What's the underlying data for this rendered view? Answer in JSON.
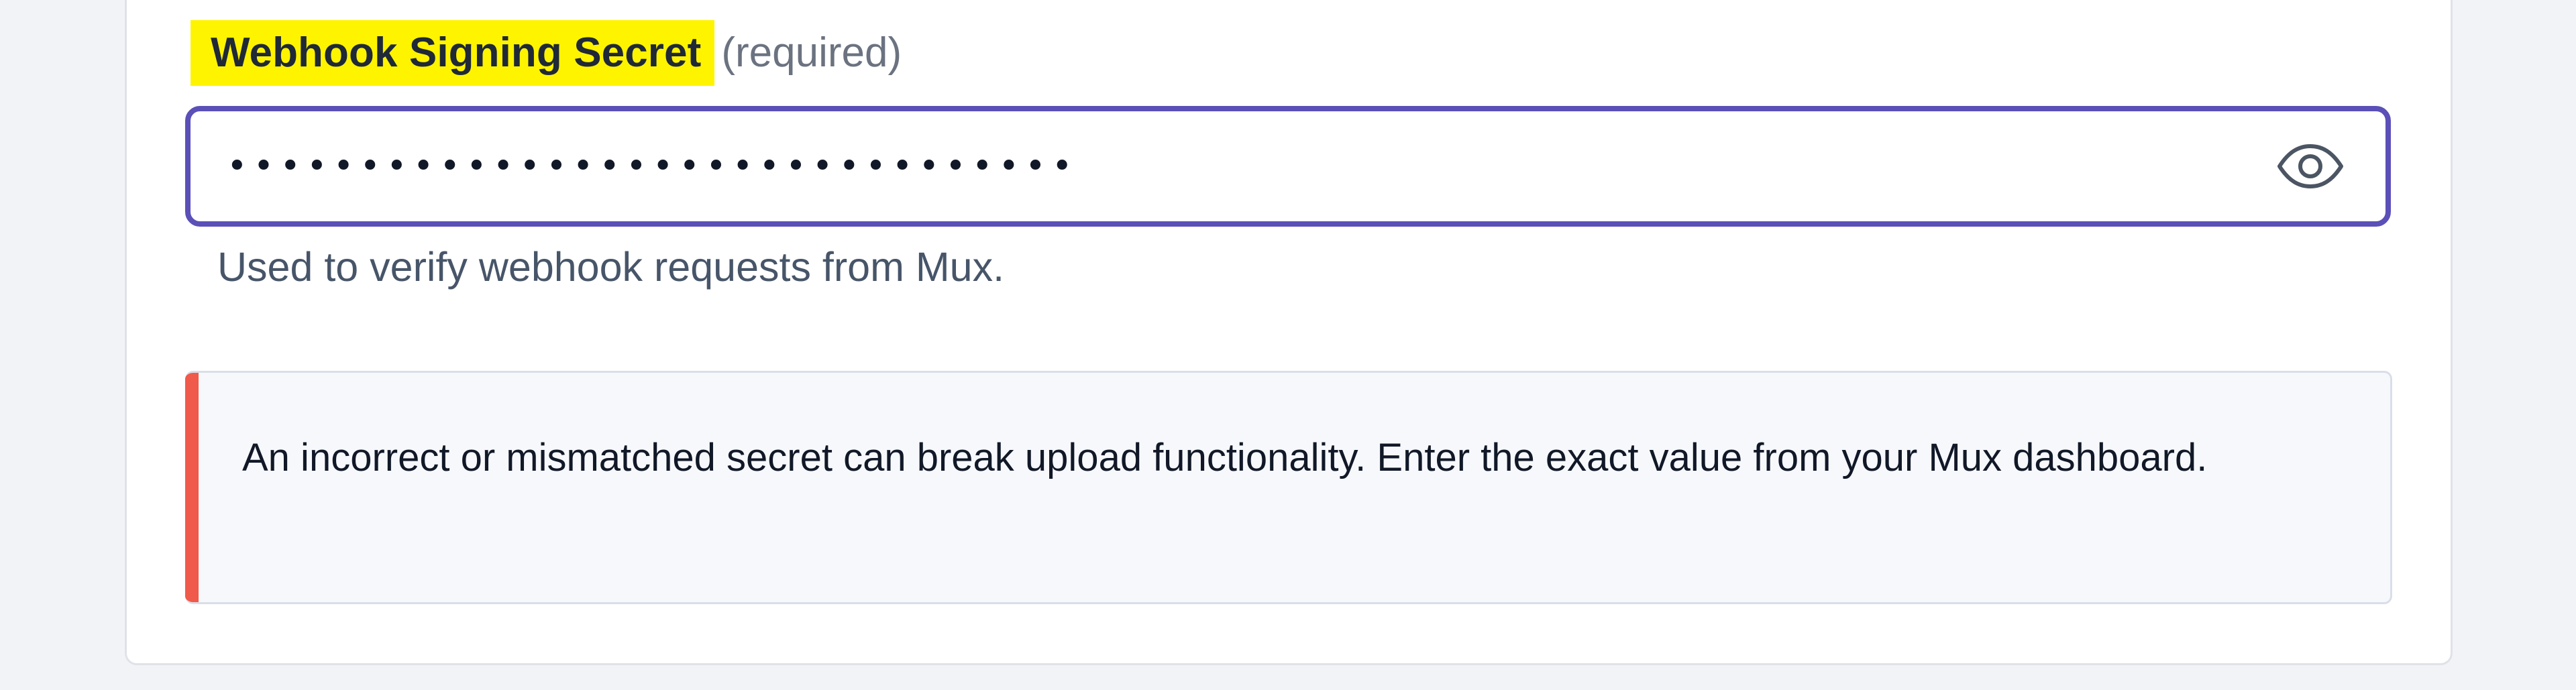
{
  "webhook_secret_field": {
    "label": "Webhook Signing Secret",
    "required_text": "(required)",
    "masked_value": "••••••••••••••••••••••••••••••••",
    "help_text": "Used to verify webhook requests from Mux.",
    "visibility_icon": "eye-icon"
  },
  "warning": {
    "message": "An incorrect or mismatched secret can break upload functionality. Enter the exact value from your Mux dashboard.",
    "accent_color": "#ef5a4a"
  },
  "colors": {
    "label_highlight": "#fff400",
    "input_border": "#5b50b8",
    "help_text": "#475569",
    "warning_background": "#f7f8fc"
  }
}
